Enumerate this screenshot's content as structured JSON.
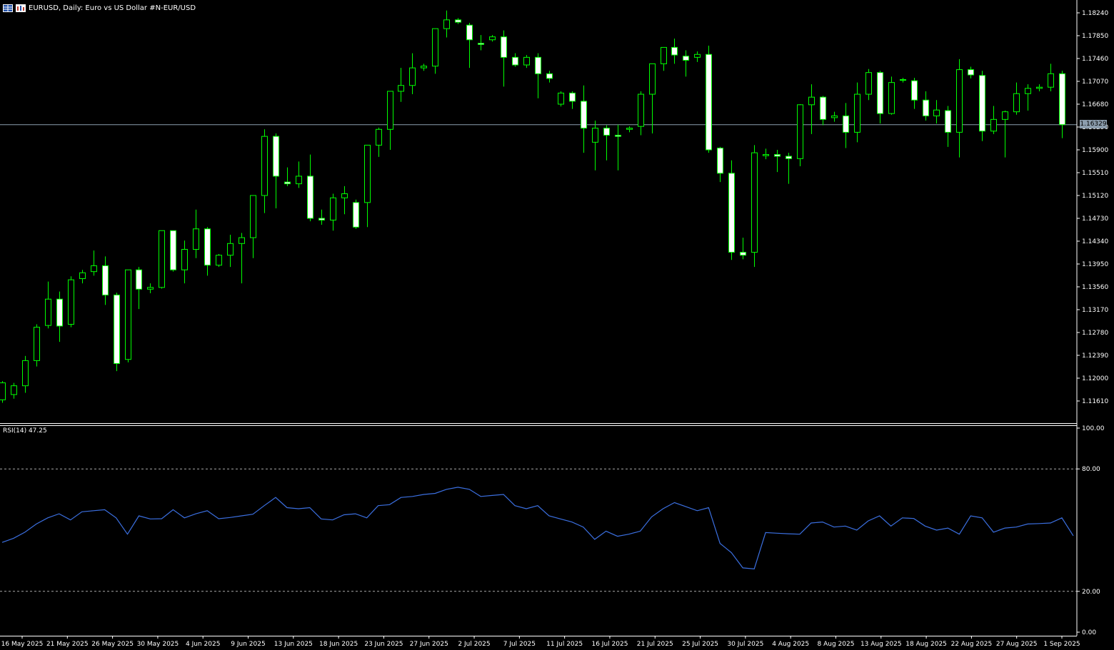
{
  "window": {
    "title": "EURUSD, Daily:  Euro vs US Dollar #N-EUR/USD",
    "icons": [
      "symbol-grid-icon",
      "chart-type-icon"
    ]
  },
  "indicator": {
    "label": "RSI(14) 47.25"
  },
  "current_price": "1.16329",
  "colors": {
    "background": "#000000",
    "candle_outline": "#00ff00",
    "bull_body": "#000000",
    "bear_body": "#ffffff",
    "rsi_line": "#3b6fe0",
    "axis": "#ffffff",
    "price_line": "#8c9dad"
  },
  "chart_data": [
    {
      "type": "candlestick",
      "symbol": "EURUSD",
      "timeframe": "Daily",
      "ylim": [
        1.1122,
        1.1863
      ],
      "y_ticks": [
        "1.18240",
        "1.17850",
        "1.17460",
        "1.17070",
        "1.16680",
        "1.16290",
        "1.15900",
        "1.15510",
        "1.15120",
        "1.14730",
        "1.14340",
        "1.13950",
        "1.13560",
        "1.13170",
        "1.12780",
        "1.12390",
        "1.12000",
        "1.11610"
      ],
      "x_ticks": [
        "16 May 2025",
        "21 May 2025",
        "26 May 2025",
        "30 May 2025",
        "4 Jun 2025",
        "9 Jun 2025",
        "13 Jun 2025",
        "18 Jun 2025",
        "23 Jun 2025",
        "27 Jun 2025",
        "2 Jul 2025",
        "7 Jul 2025",
        "11 Jul 2025",
        "16 Jul 2025",
        "21 Jul 2025",
        "25 Jul 2025",
        "30 Jul 2025",
        "4 Aug 2025",
        "8 Aug 2025",
        "13 Aug 2025",
        "18 Aug 2025",
        "22 Aug 2025",
        "27 Aug 2025",
        "1 Sep 2025"
      ],
      "ohlc": [
        [
          1.1163,
          1.1195,
          1.1158,
          1.1192
        ],
        [
          1.1172,
          1.1192,
          1.1165,
          1.1187
        ],
        [
          1.1187,
          1.1238,
          1.1175,
          1.123
        ],
        [
          1.123,
          1.1292,
          1.122,
          1.1287
        ],
        [
          1.129,
          1.1365,
          1.1285,
          1.1335
        ],
        [
          1.1335,
          1.1348,
          1.1262,
          1.1289
        ],
        [
          1.1292,
          1.1374,
          1.1287,
          1.1368
        ],
        [
          1.137,
          1.1385,
          1.1362,
          1.138
        ],
        [
          1.1382,
          1.1418,
          1.1375,
          1.1392
        ],
        [
          1.1392,
          1.1408,
          1.1325,
          1.1342
        ],
        [
          1.1342,
          1.1346,
          1.1212,
          1.1225
        ],
        [
          1.1232,
          1.1385,
          1.1227,
          1.1385
        ],
        [
          1.1385,
          1.139,
          1.1318,
          1.1352
        ],
        [
          1.1352,
          1.1362,
          1.1345,
          1.1355
        ],
        [
          1.1355,
          1.1452,
          1.1353,
          1.1452
        ],
        [
          1.1452,
          1.1452,
          1.1382,
          1.1385
        ],
        [
          1.1385,
          1.1435,
          1.1362,
          1.142
        ],
        [
          1.142,
          1.1488,
          1.1405,
          1.1455
        ],
        [
          1.1455,
          1.1458,
          1.1375,
          1.1393
        ],
        [
          1.1393,
          1.1412,
          1.139,
          1.141
        ],
        [
          1.141,
          1.1445,
          1.139,
          1.143
        ],
        [
          1.143,
          1.1448,
          1.1362,
          1.144
        ],
        [
          1.144,
          1.1512,
          1.1405,
          1.1512
        ],
        [
          1.1512,
          1.1625,
          1.1482,
          1.1613
        ],
        [
          1.1613,
          1.1618,
          1.149,
          1.1545
        ],
        [
          1.1535,
          1.156,
          1.1528,
          1.1532
        ],
        [
          1.1532,
          1.157,
          1.1525,
          1.1545
        ],
        [
          1.1545,
          1.1582,
          1.1468,
          1.1473
        ],
        [
          1.1473,
          1.1488,
          1.1462,
          1.147
        ],
        [
          1.147,
          1.1515,
          1.1452,
          1.1508
        ],
        [
          1.1508,
          1.1528,
          1.148,
          1.1515
        ],
        [
          1.15,
          1.1505,
          1.1455,
          1.1458
        ],
        [
          1.15,
          1.1598,
          1.1458,
          1.1598
        ],
        [
          1.1598,
          1.1628,
          1.1578,
          1.1625
        ],
        [
          1.1625,
          1.1662,
          1.159,
          1.169
        ],
        [
          1.169,
          1.173,
          1.1672,
          1.17
        ],
        [
          1.17,
          1.1755,
          1.1685,
          1.173
        ],
        [
          1.173,
          1.1737,
          1.1725,
          1.1733
        ],
        [
          1.1733,
          1.1797,
          1.172,
          1.1797
        ],
        [
          1.1797,
          1.1828,
          1.1782,
          1.1812
        ],
        [
          1.1812,
          1.1815,
          1.1805,
          1.1808
        ],
        [
          1.1803,
          1.1807,
          1.173,
          1.1778
        ],
        [
          1.1772,
          1.1786,
          1.176,
          1.177
        ],
        [
          1.1778,
          1.1786,
          1.1775,
          1.1783
        ],
        [
          1.1783,
          1.1794,
          1.1698,
          1.1748
        ],
        [
          1.1748,
          1.1755,
          1.1732,
          1.1735
        ],
        [
          1.1735,
          1.1752,
          1.173,
          1.1748
        ],
        [
          1.1748,
          1.1755,
          1.1678,
          1.172
        ],
        [
          1.172,
          1.1725,
          1.1705,
          1.1712
        ],
        [
          1.1668,
          1.169,
          1.1664,
          1.1687
        ],
        [
          1.1687,
          1.169,
          1.166,
          1.1673
        ],
        [
          1.1673,
          1.17,
          1.1585,
          1.1627
        ],
        [
          1.1603,
          1.164,
          1.1555,
          1.1627
        ],
        [
          1.1627,
          1.1632,
          1.1572,
          1.1615
        ],
        [
          1.1615,
          1.1633,
          1.1555,
          1.1613
        ],
        [
          1.1625,
          1.163,
          1.162,
          1.1627
        ],
        [
          1.163,
          1.169,
          1.1615,
          1.1685
        ],
        [
          1.1685,
          1.172,
          1.1618,
          1.1737
        ],
        [
          1.1737,
          1.176,
          1.1725,
          1.1765
        ],
        [
          1.1765,
          1.178,
          1.1737,
          1.1752
        ],
        [
          1.175,
          1.176,
          1.1715,
          1.1743
        ],
        [
          1.1748,
          1.1758,
          1.174,
          1.1753
        ],
        [
          1.1753,
          1.1768,
          1.1585,
          1.159
        ],
        [
          1.1593,
          1.1595,
          1.1535,
          1.155
        ],
        [
          1.155,
          1.1572,
          1.1402,
          1.1415
        ],
        [
          1.1415,
          1.144,
          1.1403,
          1.141
        ],
        [
          1.1415,
          1.1598,
          1.139,
          1.1585
        ],
        [
          1.158,
          1.1592,
          1.1574,
          1.1582
        ],
        [
          1.1582,
          1.159,
          1.1552,
          1.1579
        ],
        [
          1.1579,
          1.1585,
          1.1532,
          1.1575
        ],
        [
          1.1575,
          1.1668,
          1.1562,
          1.1667
        ],
        [
          1.1667,
          1.1702,
          1.1617,
          1.168
        ],
        [
          1.168,
          1.1682,
          1.1632,
          1.1642
        ],
        [
          1.1645,
          1.1655,
          1.1638,
          1.1648
        ],
        [
          1.1648,
          1.167,
          1.1593,
          1.162
        ],
        [
          1.162,
          1.1705,
          1.1603,
          1.1685
        ],
        [
          1.1685,
          1.1728,
          1.1675,
          1.1722
        ],
        [
          1.1722,
          1.1725,
          1.1635,
          1.1652
        ],
        [
          1.1652,
          1.1715,
          1.165,
          1.1705
        ],
        [
          1.171,
          1.1713,
          1.1705,
          1.171
        ],
        [
          1.1708,
          1.1713,
          1.166,
          1.1675
        ],
        [
          1.1675,
          1.169,
          1.164,
          1.1648
        ],
        [
          1.1648,
          1.1675,
          1.1635,
          1.1658
        ],
        [
          1.1657,
          1.1665,
          1.1595,
          1.162
        ],
        [
          1.162,
          1.1745,
          1.1577,
          1.1727
        ],
        [
          1.1727,
          1.1732,
          1.1712,
          1.1718
        ],
        [
          1.1717,
          1.1725,
          1.1605,
          1.1622
        ],
        [
          1.1622,
          1.1665,
          1.1617,
          1.1642
        ],
        [
          1.1642,
          1.1657,
          1.1577,
          1.1655
        ],
        [
          1.1655,
          1.1705,
          1.165,
          1.1686
        ],
        [
          1.1686,
          1.1702,
          1.1657,
          1.1695
        ],
        [
          1.1695,
          1.1702,
          1.169,
          1.1697
        ],
        [
          1.1697,
          1.1737,
          1.169,
          1.172
        ],
        [
          1.172,
          1.1725,
          1.161,
          1.1633
        ]
      ]
    },
    {
      "type": "line",
      "title": "RSI(14) 47.25",
      "ylim": [
        0,
        100
      ],
      "y_ticks": [
        "100.00",
        "80.00",
        "20.00",
        "0.00"
      ],
      "levels": [
        80,
        20
      ],
      "values": [
        44,
        46,
        49,
        53,
        56,
        58,
        55,
        59,
        59.5,
        60,
        56,
        48,
        57,
        55.5,
        55.6,
        60,
        56,
        58,
        59.5,
        55.6,
        56.2,
        57,
        57.8,
        62,
        66,
        61,
        60.5,
        61,
        55.5,
        55,
        57.5,
        58,
        56,
        62,
        62.5,
        66,
        66.5,
        67.5,
        68,
        70,
        71,
        70,
        66.5,
        67,
        67.5,
        62,
        60.5,
        62,
        57,
        55.5,
        54,
        51.5,
        45.5,
        49.5,
        47,
        48,
        49.5,
        56.5,
        60.5,
        63.5,
        61.5,
        59.5,
        61,
        43.5,
        39,
        31.5,
        31,
        48.8,
        48.5,
        48.2,
        48,
        53.5,
        54,
        51.5,
        52,
        50,
        54.5,
        57,
        52,
        56,
        55.7,
        52,
        50,
        51,
        48,
        57,
        56,
        49,
        51,
        51.5,
        53,
        53.2,
        53.5,
        56,
        47.25
      ]
    }
  ]
}
